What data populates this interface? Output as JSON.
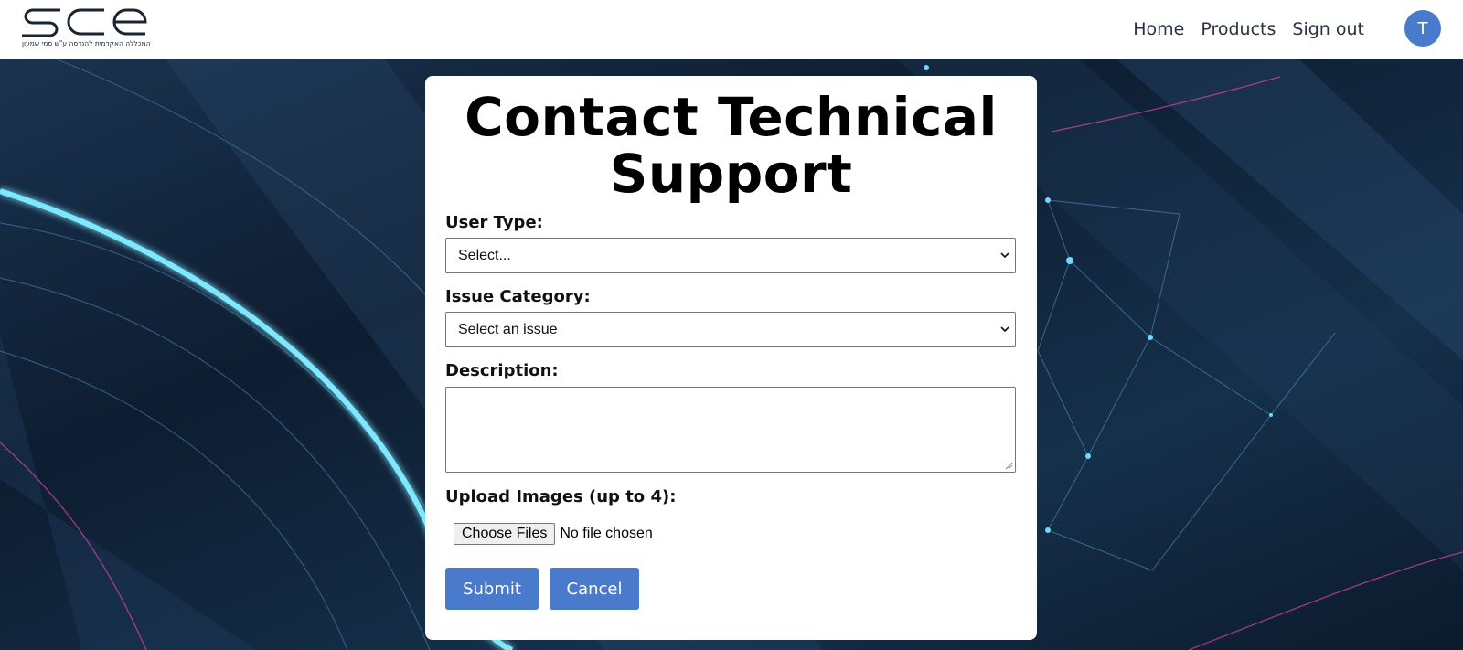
{
  "header": {
    "logo_text": "sce",
    "logo_tagline": "המכללה האקדמית להנדסה ע\"ש סמי שמעון",
    "nav": [
      {
        "label": "Home"
      },
      {
        "label": "Products"
      },
      {
        "label": "Sign out"
      }
    ],
    "avatar_initial": "T"
  },
  "form": {
    "title": "Contact Technical Support",
    "user_type": {
      "label": "User Type:",
      "selected": "Select..."
    },
    "issue_category": {
      "label": "Issue Category:",
      "selected": "Select an issue"
    },
    "description": {
      "label": "Description:",
      "value": ""
    },
    "upload": {
      "label": "Upload Images (up to 4):",
      "button": "Choose Files",
      "status": "No file chosen"
    },
    "submit_label": "Submit",
    "cancel_label": "Cancel"
  },
  "colors": {
    "accent": "#4a7acb",
    "background": "#0f1c2e",
    "glow": "#7ee8ff",
    "pink_line": "#d64fa8"
  }
}
